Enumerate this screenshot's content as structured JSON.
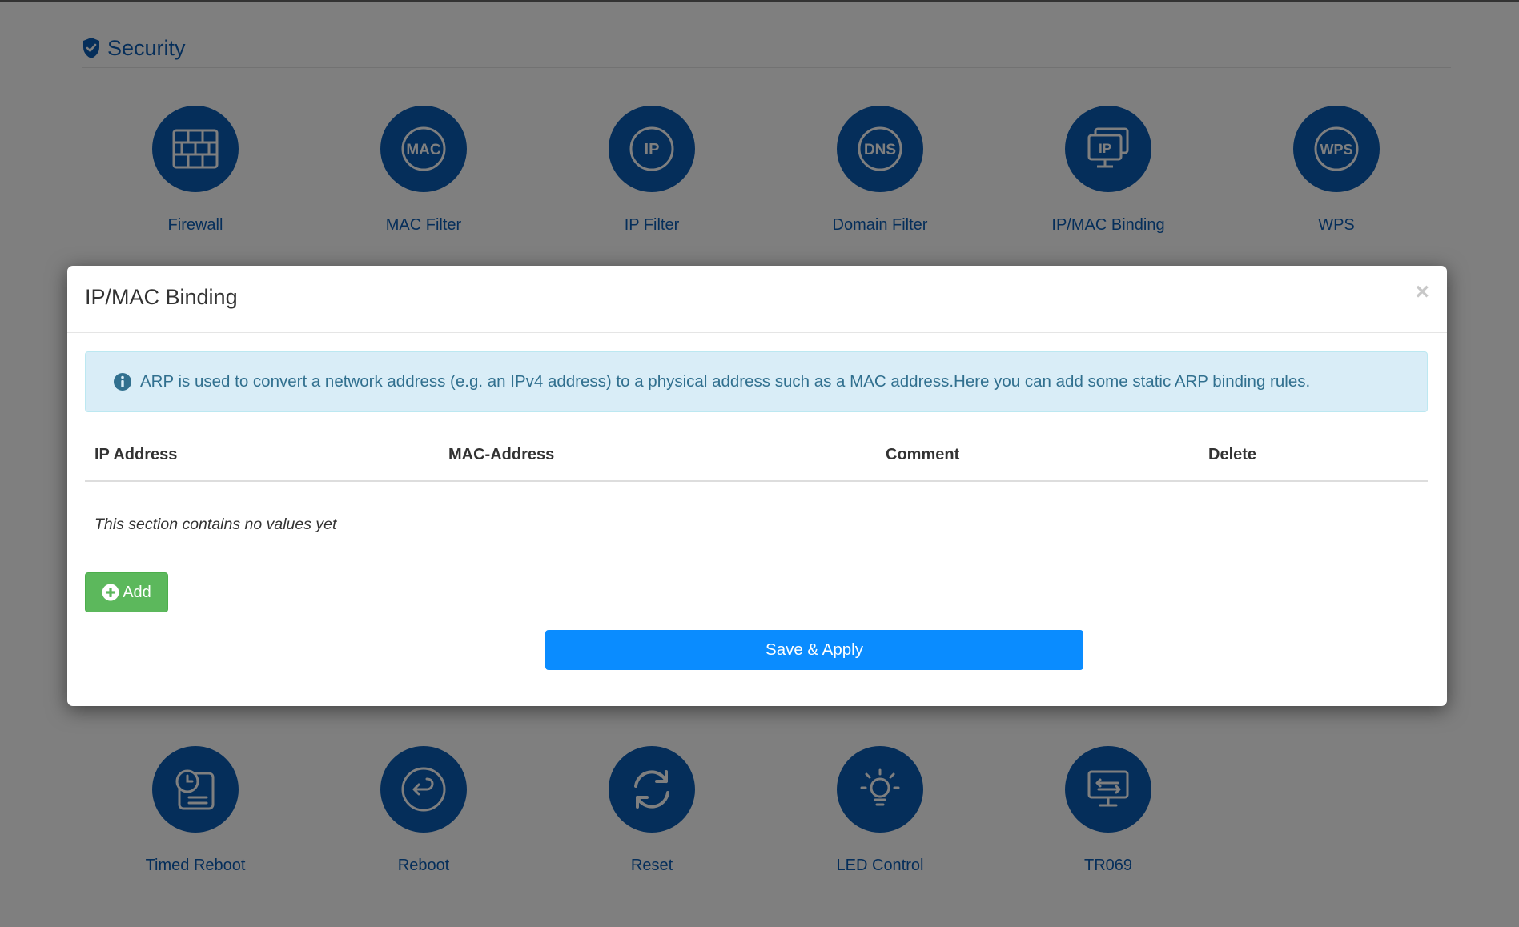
{
  "section": {
    "title": "Security"
  },
  "tiles_top": [
    {
      "label": "Firewall",
      "icon": "firewall-icon"
    },
    {
      "label": "MAC Filter",
      "icon": "mac-filter-icon",
      "badge": "MAC"
    },
    {
      "label": "IP Filter",
      "icon": "ip-filter-icon",
      "badge": "IP"
    },
    {
      "label": "Domain Filter",
      "icon": "dns-filter-icon",
      "badge": "DNS"
    },
    {
      "label": "IP/MAC Binding",
      "icon": "ip-mac-binding-icon",
      "badge": "IP"
    },
    {
      "label": "WPS",
      "icon": "wps-icon",
      "badge": "WPS"
    }
  ],
  "tiles_bottom": [
    {
      "label": "Timed Reboot",
      "icon": "timed-reboot-icon"
    },
    {
      "label": "Reboot",
      "icon": "reboot-icon"
    },
    {
      "label": "Reset",
      "icon": "reset-icon"
    },
    {
      "label": "LED Control",
      "icon": "led-control-icon"
    },
    {
      "label": "TR069",
      "icon": "tr069-icon"
    }
  ],
  "modal": {
    "title": "IP/MAC Binding",
    "close_label": "×",
    "alert_text": "ARP is used to convert a network address (e.g. an IPv4 address) to a physical address such as a MAC address.Here you can add some static ARP binding rules.",
    "columns": [
      "IP Address",
      "MAC-Address",
      "Comment",
      "Delete"
    ],
    "empty_text": "This section contains no values yet",
    "add_label": "Add",
    "save_label": "Save & Apply"
  },
  "colors": {
    "brand_blue": "#0a5cb5",
    "alert_bg": "#d9edf7",
    "alert_text": "#31708f",
    "add_green": "#5cb85c",
    "save_blue": "#0a8cff"
  }
}
